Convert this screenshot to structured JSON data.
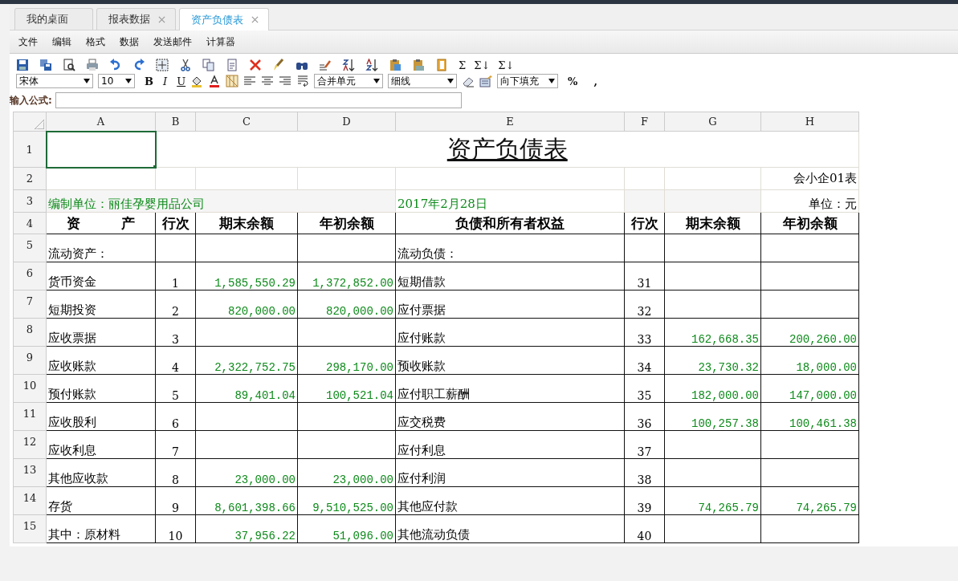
{
  "tabs": [
    {
      "label": "我的桌面",
      "closable": false,
      "selected": false
    },
    {
      "label": "报表数据",
      "closable": true,
      "selected": false
    },
    {
      "label": "资产负债表",
      "closable": true,
      "selected": true
    }
  ],
  "menu": [
    "文件",
    "编辑",
    "格式",
    "数据",
    "发送邮件",
    "计算器"
  ],
  "toolbar": {
    "sum_buttons": [
      "Σ",
      "Σ↓",
      "Σ↓"
    ],
    "font": "宋体",
    "size": "10",
    "bold": "B",
    "italic": "I",
    "underline": "U",
    "merge": "合并单元",
    "border": "细线",
    "fill": "向下填充",
    "percent": "%",
    "comma": ","
  },
  "formula": {
    "label": "输入公式:"
  },
  "sheet": {
    "columns": [
      "A",
      "B",
      "C",
      "D",
      "E",
      "F",
      "G",
      "H"
    ],
    "row_numbers": [
      "1",
      "2",
      "3",
      "4",
      "5",
      "6",
      "7",
      "8",
      "9",
      "10",
      "11",
      "12",
      "13",
      "14",
      "15"
    ],
    "a1_selected": true,
    "title": "资产负债表",
    "form_code": "会小企01表",
    "company": "编制单位：丽佳孕婴用品公司",
    "date": "2017年2月28日",
    "unit": "单位：元",
    "headers": [
      "资　　　产",
      "行次",
      "期末余额",
      "年初余额",
      "负债和所有者权益",
      "行次",
      "期末余额",
      "年初余额"
    ],
    "rows": [
      [
        "流动资产：",
        "",
        "",
        "",
        "流动负债：",
        "",
        "",
        ""
      ],
      [
        "货币资金",
        "1",
        "1,585,550.29",
        "1,372,852.00",
        "短期借款",
        "31",
        "",
        ""
      ],
      [
        "短期投资",
        "2",
        "820,000.00",
        "820,000.00",
        "应付票据",
        "32",
        "",
        ""
      ],
      [
        "应收票据",
        "3",
        "",
        "",
        "应付账款",
        "33",
        "162,668.35",
        "200,260.00"
      ],
      [
        "应收账款",
        "4",
        "2,322,752.75",
        "298,170.00",
        "预收账款",
        "34",
        "23,730.32",
        "18,000.00"
      ],
      [
        "预付账款",
        "5",
        "89,401.04",
        "100,521.04",
        "应付职工薪酬",
        "35",
        "182,000.00",
        "147,000.00"
      ],
      [
        "应收股利",
        "6",
        "",
        "",
        "应交税费",
        "36",
        "100,257.38",
        "100,461.38"
      ],
      [
        "应收利息",
        "7",
        "",
        "",
        "应付利息",
        "37",
        "",
        ""
      ],
      [
        "其他应收款",
        "8",
        "23,000.00",
        "23,000.00",
        "应付利润",
        "38",
        "",
        ""
      ],
      [
        "存货",
        "9",
        "8,601,398.66",
        "9,510,525.00",
        "其他应付款",
        "39",
        "74,265.79",
        "74,265.79"
      ],
      [
        "其中：原材料",
        "10",
        "37,956.22",
        "51,096.00",
        "其他流动负债",
        "40",
        "",
        ""
      ]
    ]
  }
}
